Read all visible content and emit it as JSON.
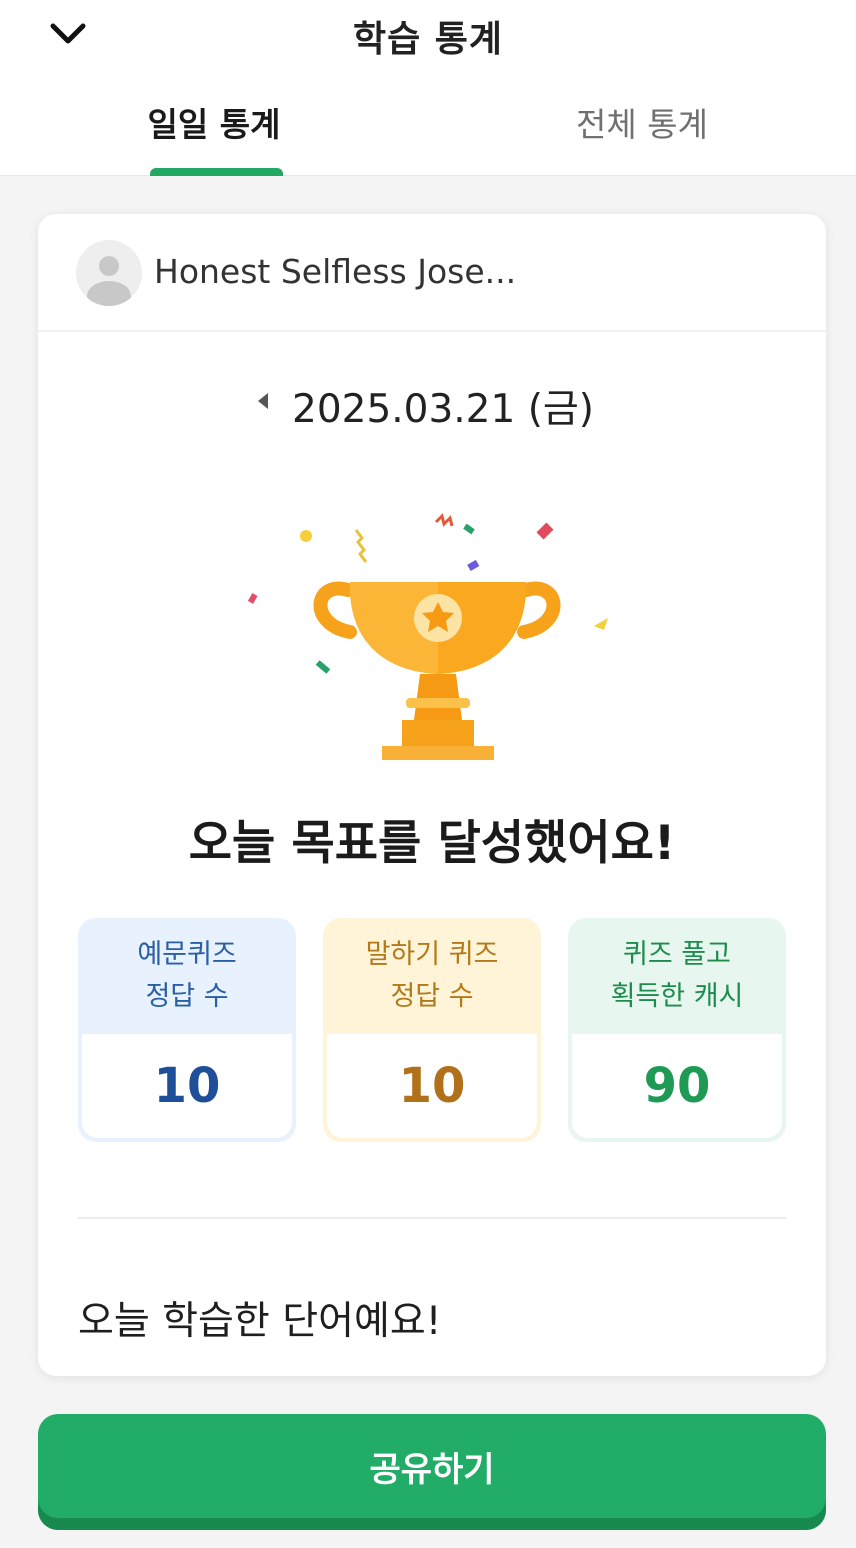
{
  "header": {
    "title": "학습 통계",
    "back_icon": "chevron-down-icon"
  },
  "tabs": [
    {
      "label": "일일 통계",
      "active": true
    },
    {
      "label": "전체 통계",
      "active": false
    }
  ],
  "colors": {
    "accent": "#21a862",
    "blue_text": "#2a5fa6",
    "yellow_text": "#b27a1a",
    "green_text": "#1e8c4f",
    "trophy": "#f7a21b"
  },
  "card": {
    "username": "Honest Selfless Jose...",
    "date": "2025.03.21 (금)",
    "achievement": "오늘 목표를 달성했어요!",
    "stats": [
      {
        "label_line1": "예문퀴즈",
        "label_line2": "정답 수",
        "value": "10"
      },
      {
        "label_line1": "말하기 퀴즈",
        "label_line2": "정답 수",
        "value": "10"
      },
      {
        "label_line1": "퀴즈 풀고",
        "label_line2": "획득한 캐시",
        "value": "90"
      }
    ],
    "words_title": "오늘 학습한 단어예요!"
  },
  "share_button": "공유하기"
}
